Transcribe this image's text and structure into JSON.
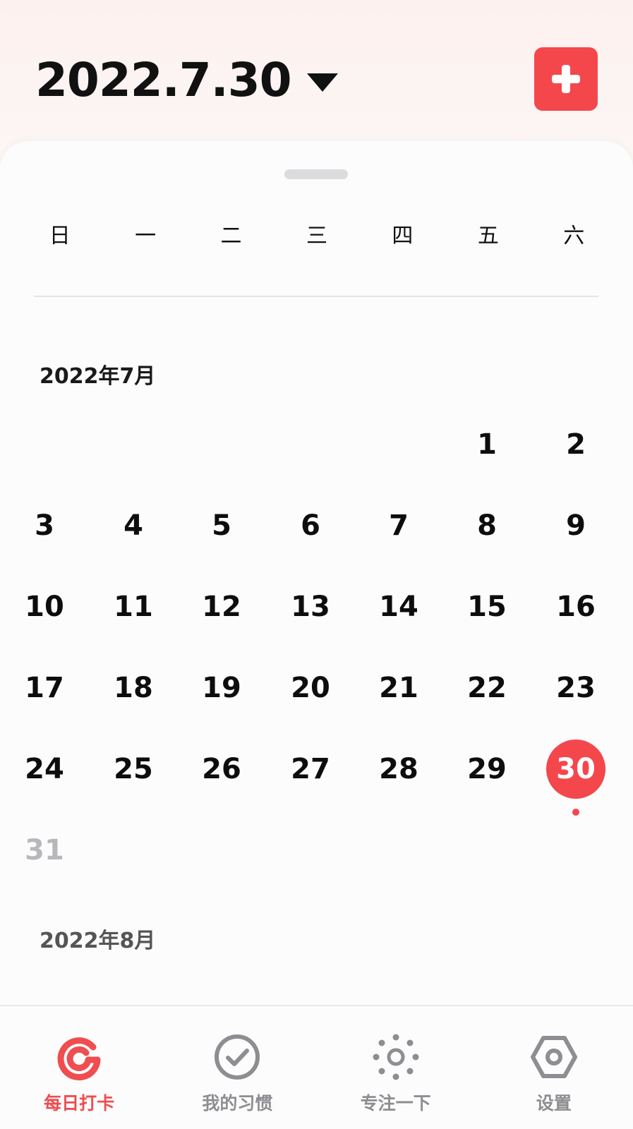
{
  "header": {
    "date_title": "2022.7.30",
    "add_button_label": "+"
  },
  "weekdays": [
    "日",
    "一",
    "二",
    "三",
    "四",
    "五",
    "六"
  ],
  "calendar": {
    "july_label": "2022年7月",
    "august_label": "2022年8月",
    "weeks": [
      [
        "",
        "",
        "",
        "",
        "",
        "1",
        "2"
      ],
      [
        "3",
        "4",
        "5",
        "6",
        "7",
        "8",
        "9"
      ],
      [
        "10",
        "11",
        "12",
        "13",
        "14",
        "15",
        "16"
      ],
      [
        "17",
        "18",
        "19",
        "20",
        "21",
        "22",
        "23"
      ],
      [
        "24",
        "25",
        "26",
        "27",
        "28",
        "29",
        "30"
      ],
      [
        "31",
        "",
        "",
        "",
        "",
        "",
        ""
      ]
    ],
    "selected_day": "30",
    "muted_days": [
      "31"
    ]
  },
  "tabs": [
    {
      "label": "每日打卡",
      "icon": "checkin-icon",
      "active": true
    },
    {
      "label": "我的习惯",
      "icon": "check-circle-icon",
      "active": false
    },
    {
      "label": "专注一下",
      "icon": "focus-dots-icon",
      "active": false
    },
    {
      "label": "设置",
      "icon": "settings-hexagon-icon",
      "active": false
    }
  ],
  "colors": {
    "accent": "#f4474c",
    "tab_active": "#ef4d50",
    "tab_inactive": "#8e8e92"
  }
}
